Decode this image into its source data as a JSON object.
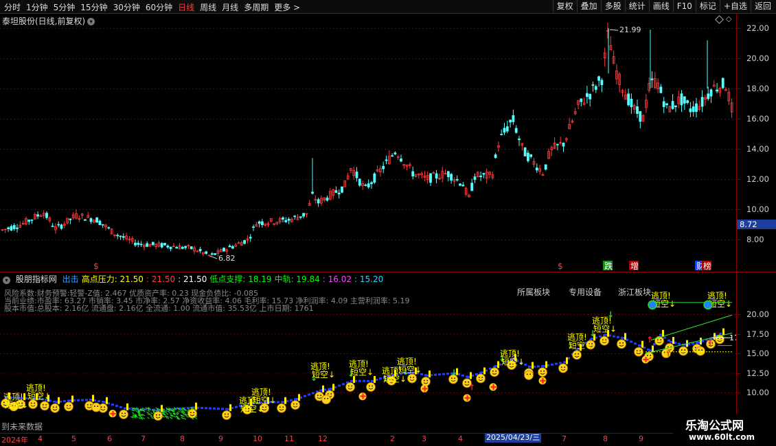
{
  "toolbar": {
    "periods": [
      "分时",
      "1分钟",
      "5分钟",
      "15分钟",
      "30分钟",
      "60分钟",
      "日线",
      "周线",
      "月线",
      "多周期",
      "更多 >"
    ],
    "active_period": "日线",
    "right_buttons": [
      "复权",
      "叠加",
      "多股",
      "统计",
      "画线",
      "F10",
      "标记",
      "+自选",
      "返回"
    ]
  },
  "main_chart": {
    "stock_title": "泰坦股份(日线,前复权)",
    "high_label": "21.99",
    "low_label": "6.82",
    "price_axis": [
      "22.00",
      "20.00",
      "18.00",
      "16.00",
      "14.00",
      "12.00",
      "10.00",
      "8.00"
    ],
    "current_price": "8.72",
    "event_markers": [
      "$",
      "$",
      "跌",
      "增",
      "财",
      "榜"
    ]
  },
  "indicator": {
    "name": "股朋指标网",
    "legend": [
      {
        "text": "出击",
        "color": "#3aa0ff"
      },
      {
        "text": "高点压力: 21.50",
        "color": "#ffff00"
      },
      {
        "text": ": 21.50",
        "color": "#ff4040"
      },
      {
        "text": ": 21.50",
        "color": "#ffffff"
      },
      {
        "text": "低点支撑: 18.19",
        "color": "#00ff00"
      },
      {
        "text": "中轨: 19.84",
        "color": "#00ff00"
      },
      {
        "text": ": 16.02",
        "color": "#ff44ff"
      },
      {
        "text": ": 15.20",
        "color": "#33ccff"
      }
    ],
    "info_lines": [
      "风险系数:财务预警:轻警-Z值: 2.467 优质资产率: 0.23 现金负债比: -0.085",
      "当前业绩:市盈率: 63.27 市销率: 3.45 市净率: 2.57 净资收益率: 4.06 毛利率: 15.73 净利润率: 4.09 主营利润率: 5.19",
      "股本市值:总股本: 2.16亿 流通盘: 2.16亿 全流通: 1.00 流通市值: 35.53亿 上市日期: 1761"
    ],
    "sector_tags": [
      {
        "text": "所属板块",
        "color": "#3a7cff"
      },
      {
        "text": "专用设备",
        "color": "#ff3b3b"
      },
      {
        "text": "浙江板块",
        "color": "#ffffff"
      }
    ],
    "signal_top": "逃顶!",
    "signal_short": "短空↓",
    "right_label": "17",
    "future_note": "到未来数据",
    "price_axis": [
      "20.00",
      "17.50",
      "15.00",
      "12.50",
      "10.00"
    ]
  },
  "date_axis": {
    "labels": [
      "2024年",
      "4",
      "5",
      "6",
      "7",
      "8",
      "9",
      "10",
      "11",
      "12",
      "2",
      "3",
      "4",
      "5",
      "7",
      "8",
      "9"
    ],
    "selected_date": "2025/04/23/三"
  },
  "watermark": {
    "line1": "乐淘公式网",
    "line2": "www.60lt.com"
  },
  "colors": {
    "up": "#ff3b3b",
    "down": "#54ffff",
    "grid": "#8b0000",
    "axis_bg": "#000000"
  }
}
